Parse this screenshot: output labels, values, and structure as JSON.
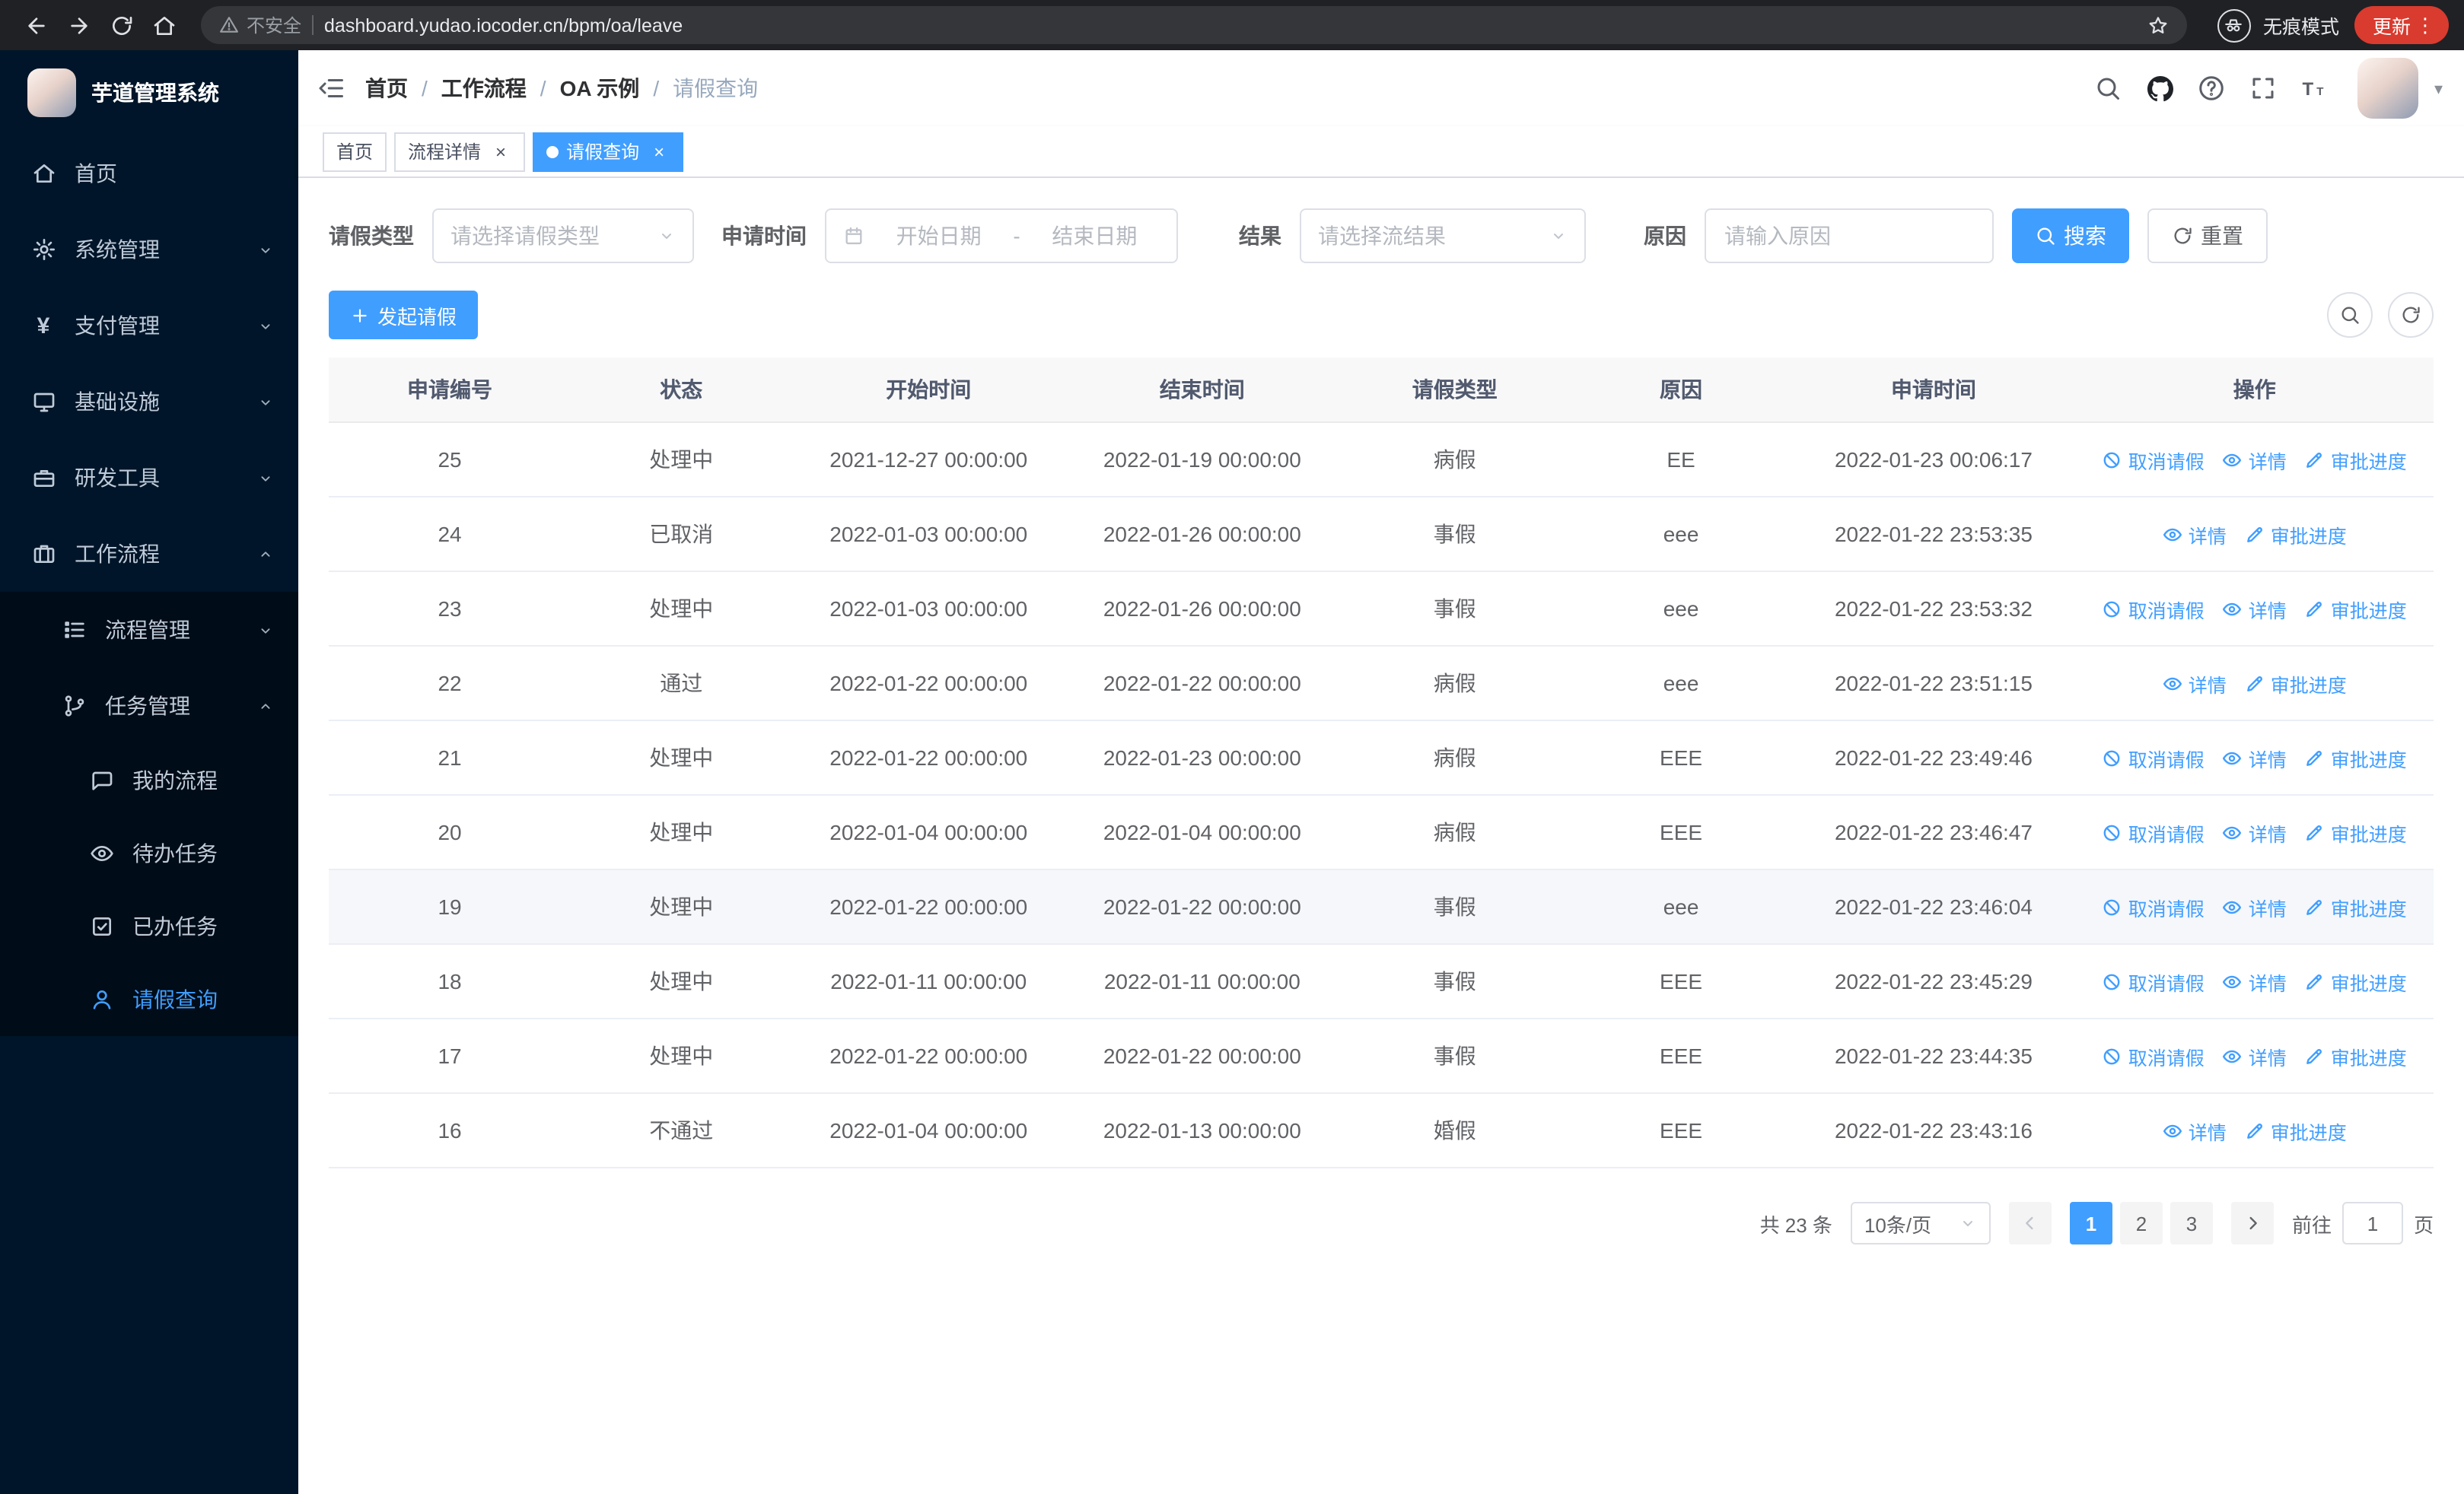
{
  "browser": {
    "security_label": "不安全",
    "url": "dashboard.yudao.iocoder.cn/bpm/oa/leave",
    "incognito_label": "无痕模式",
    "update_label": "更新"
  },
  "sidebar": {
    "logo_title": "芋道管理系统",
    "items": [
      {
        "label": "首页"
      },
      {
        "label": "系统管理"
      },
      {
        "label": "支付管理"
      },
      {
        "label": "基础设施"
      },
      {
        "label": "研发工具"
      },
      {
        "label": "工作流程"
      },
      {
        "label": "流程管理"
      },
      {
        "label": "任务管理"
      },
      {
        "label": "我的流程"
      },
      {
        "label": "待办任务"
      },
      {
        "label": "已办任务"
      },
      {
        "label": "请假查询"
      }
    ]
  },
  "breadcrumb": {
    "items": [
      "首页",
      "工作流程",
      "OA 示例",
      "请假查询"
    ],
    "separator": "/"
  },
  "tabs": [
    {
      "label": "首页",
      "closable": false,
      "active": false
    },
    {
      "label": "流程详情",
      "closable": true,
      "active": false
    },
    {
      "label": "请假查询",
      "closable": true,
      "active": true
    }
  ],
  "filters": {
    "leave_type_label": "请假类型",
    "leave_type_placeholder": "请选择请假类型",
    "apply_time_label": "申请时间",
    "date_start_placeholder": "开始日期",
    "date_separator": "-",
    "date_end_placeholder": "结束日期",
    "result_label": "结果",
    "result_placeholder": "请选择流结果",
    "reason_label": "原因",
    "reason_placeholder": "请输入原因",
    "search_label": "搜索",
    "reset_label": "重置"
  },
  "toolbar": {
    "create_label": "发起请假"
  },
  "table": {
    "columns": [
      "申请编号",
      "状态",
      "开始时间",
      "结束时间",
      "请假类型",
      "原因",
      "申请时间",
      "操作"
    ],
    "action_labels": {
      "cancel": "取消请假",
      "detail": "详情",
      "progress": "审批进度"
    },
    "rows": [
      {
        "id": "25",
        "status": "处理中",
        "start": "2021-12-27 00:00:00",
        "end": "2022-01-19 00:00:00",
        "type": "病假",
        "reason": "EE",
        "apply_time": "2022-01-23 00:06:17",
        "actions": [
          "cancel",
          "detail",
          "progress"
        ]
      },
      {
        "id": "24",
        "status": "已取消",
        "start": "2022-01-03 00:00:00",
        "end": "2022-01-26 00:00:00",
        "type": "事假",
        "reason": "eee",
        "apply_time": "2022-01-22 23:53:35",
        "actions": [
          "detail",
          "progress"
        ]
      },
      {
        "id": "23",
        "status": "处理中",
        "start": "2022-01-03 00:00:00",
        "end": "2022-01-26 00:00:00",
        "type": "事假",
        "reason": "eee",
        "apply_time": "2022-01-22 23:53:32",
        "actions": [
          "cancel",
          "detail",
          "progress"
        ]
      },
      {
        "id": "22",
        "status": "通过",
        "start": "2022-01-22 00:00:00",
        "end": "2022-01-22 00:00:00",
        "type": "病假",
        "reason": "eee",
        "apply_time": "2022-01-22 23:51:15",
        "actions": [
          "detail",
          "progress"
        ]
      },
      {
        "id": "21",
        "status": "处理中",
        "start": "2022-01-22 00:00:00",
        "end": "2022-01-23 00:00:00",
        "type": "病假",
        "reason": "EEE",
        "apply_time": "2022-01-22 23:49:46",
        "actions": [
          "cancel",
          "detail",
          "progress"
        ]
      },
      {
        "id": "20",
        "status": "处理中",
        "start": "2022-01-04 00:00:00",
        "end": "2022-01-04 00:00:00",
        "type": "病假",
        "reason": "EEE",
        "apply_time": "2022-01-22 23:46:47",
        "actions": [
          "cancel",
          "detail",
          "progress"
        ]
      },
      {
        "id": "19",
        "status": "处理中",
        "start": "2022-01-22 00:00:00",
        "end": "2022-01-22 00:00:00",
        "type": "事假",
        "reason": "eee",
        "apply_time": "2022-01-22 23:46:04",
        "actions": [
          "cancel",
          "detail",
          "progress"
        ],
        "highlight": true
      },
      {
        "id": "18",
        "status": "处理中",
        "start": "2022-01-11 00:00:00",
        "end": "2022-01-11 00:00:00",
        "type": "事假",
        "reason": "EEE",
        "apply_time": "2022-01-22 23:45:29",
        "actions": [
          "cancel",
          "detail",
          "progress"
        ]
      },
      {
        "id": "17",
        "status": "处理中",
        "start": "2022-01-22 00:00:00",
        "end": "2022-01-22 00:00:00",
        "type": "事假",
        "reason": "EEE",
        "apply_time": "2022-01-22 23:44:35",
        "actions": [
          "cancel",
          "detail",
          "progress"
        ]
      },
      {
        "id": "16",
        "status": "不通过",
        "start": "2022-01-04 00:00:00",
        "end": "2022-01-13 00:00:00",
        "type": "婚假",
        "reason": "EEE",
        "apply_time": "2022-01-22 23:43:16",
        "actions": [
          "detail",
          "progress"
        ]
      }
    ]
  },
  "pagination": {
    "total_label": "共 23 条",
    "page_size_label": "10条/页",
    "pages": [
      "1",
      "2",
      "3"
    ],
    "active_page": "1",
    "goto_prefix": "前往",
    "goto_value": "1",
    "goto_suffix": "页"
  }
}
